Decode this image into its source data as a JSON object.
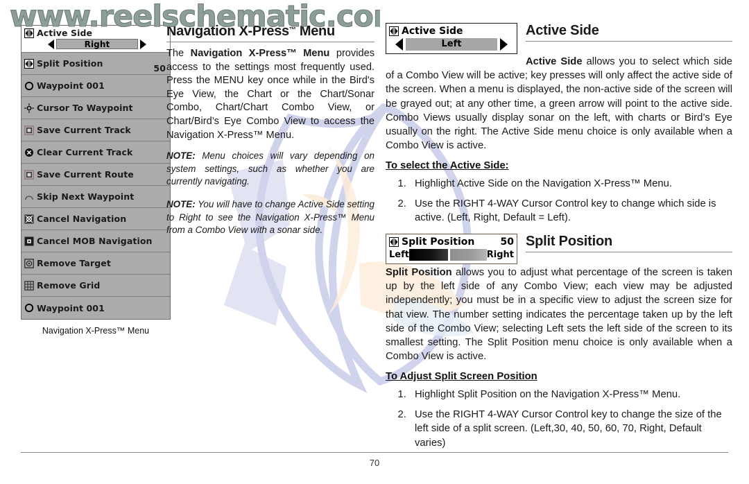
{
  "watermark": {
    "url_text": "www.reelschematic.com",
    "color": "#8d9e98",
    "logo_name": "fish-logo",
    "logo_colors": {
      "outline": "#aab0dd",
      "accent": "#fbddbe",
      "cool": "#cfe2f2"
    }
  },
  "device_menu": {
    "caption": "Navigation X-Press™ Menu",
    "items": [
      {
        "icon": "left-right-adjust-icon",
        "label": "Active Side",
        "selected": true,
        "value": "Right",
        "control": "selector"
      },
      {
        "icon": "left-right-adjust-icon",
        "label": "Split Position",
        "selected": false,
        "value": "50",
        "control": "number"
      },
      {
        "icon": "waypoint-circle-icon",
        "label": "Waypoint 001",
        "selected": false,
        "value": "",
        "control": "none"
      },
      {
        "icon": "cursor-target-icon",
        "label": "Cursor To Waypoint",
        "selected": false,
        "value": "",
        "control": "none"
      },
      {
        "icon": "save-track-icon",
        "label": "Save Current Track",
        "selected": false,
        "value": "",
        "control": "none"
      },
      {
        "icon": "clear-x-icon",
        "label": "Clear Current Track",
        "selected": false,
        "value": "",
        "control": "none"
      },
      {
        "icon": "save-route-icon",
        "label": "Save Current Route",
        "selected": false,
        "value": "",
        "control": "none"
      },
      {
        "icon": "skip-waypoint-icon",
        "label": "Skip Next Waypoint",
        "selected": false,
        "value": "",
        "control": "none"
      },
      {
        "icon": "cancel-navigation-icon",
        "label": "Cancel Navigation",
        "selected": false,
        "value": "",
        "control": "none"
      },
      {
        "icon": "cancel-mob-icon",
        "label": "Cancel MOB Navigation",
        "selected": false,
        "value": "",
        "control": "none"
      },
      {
        "icon": "remove-target-icon",
        "label": "Remove Target",
        "selected": false,
        "value": "",
        "control": "none"
      },
      {
        "icon": "remove-grid-icon",
        "label": "Remove Grid",
        "selected": false,
        "value": "",
        "control": "none"
      },
      {
        "icon": "waypoint-circle-icon",
        "label": "Waypoint 001",
        "selected": false,
        "value": "",
        "control": "none"
      }
    ]
  },
  "middle": {
    "title": "Navigation X-Press",
    "title_tm": "™",
    "title_tail": " Menu",
    "paragraph_pre": "The ",
    "paragraph_bold": "Navigation X-Press™ Menu",
    "paragraph_post": " provides access to the settings most frequently used. Press the MENU key once while in the Bird's Eye View, the Chart or the Chart/Sonar Combo, Chart/Chart Combo View, or Chart/Bird’s Eye Combo View to access the Navigation X-Press™ Menu.",
    "note1_label": "NOTE:",
    "note1_text": " Menu choices will vary depending on system settings, such as whether you are currently navigating.",
    "note2_label": "NOTE:",
    "note2_text": " You will have to change Active Side setting to Right to see the Navigation X-Press™ Menu from a Combo View with a sonar side."
  },
  "active_side": {
    "widget": {
      "icon": "left-right-adjust-icon",
      "label": "Active Side",
      "value": "Left",
      "left_arrow": "◀",
      "right_arrow": "▶"
    },
    "heading": "Active Side",
    "body_bold": "Active Side",
    "body_text": " allows you to select which side of a Combo View will be active; key presses will only affect the active side of the screen. When a menu is displayed, the non-active side of the screen will be grayed out; at any other time, a green arrow will point to the active side. Combo Views usually display sonar on the left, with charts or Bird’s Eye usually on the right. The Active Side menu choice is only available when a Combo View is active.",
    "subheading": "To select the Active Side:",
    "steps": [
      "Highlight Active Side on the Navigation X-Press™ Menu.",
      "Use the RIGHT 4-WAY Cursor Control key to change which side is active. (Left, Right, Default = Left)."
    ]
  },
  "split_position": {
    "widget": {
      "icon": "left-right-adjust-icon",
      "label": "Split Position",
      "number": "50",
      "left_label": "Left",
      "right_label": "Right",
      "fill_percent": 50
    },
    "heading": "Split Position",
    "body_bold": "Split Position",
    "body_text": " allows you to adjust what percentage of the screen is taken up by the left side of any Combo View; each view may be adjusted independently; you must be in a specific view to adjust the screen size for that view. The number setting indicates the percentage taken up by the left side of the Combo View; selecting Left sets the left side of the screen to its smallest setting. The Split Position menu choice is only available when a Combo View is active.",
    "subheading": "To Adjust Split Screen Position",
    "steps": [
      "Highlight Split Position on the Navigation X-Press™ Menu.",
      "Use the RIGHT 4-WAY Cursor Control key to change the size of the left side of a split screen. (Left,30, 40, 50, 60, 70, Right, Default varies)"
    ]
  },
  "footer": {
    "page_number": "70"
  }
}
